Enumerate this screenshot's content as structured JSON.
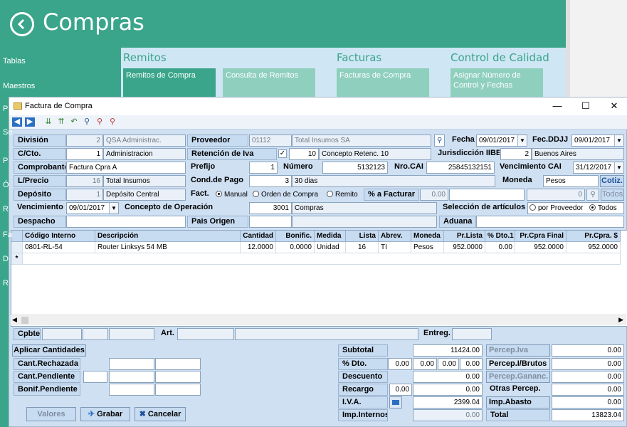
{
  "app": {
    "title": "Compras",
    "sidebar": [
      "Tablas",
      "Maestros",
      "P",
      "Se",
      "P",
      "Ó",
      "R",
      "Fa",
      "D",
      "R"
    ],
    "sections": [
      {
        "title": "Remitos",
        "tiles": [
          "Remitos de Compra",
          "Consulta de Remitos"
        ]
      },
      {
        "title": "Facturas",
        "tiles": [
          "Facturas de Compra"
        ]
      },
      {
        "title": "Control de Calidad",
        "tiles": [
          "Asignar Número de Control y Fechas"
        ]
      }
    ]
  },
  "dialog": {
    "title": "Factura de Compra",
    "header": {
      "division_label": "División",
      "division_code": "2",
      "division_name": "QSA Administrac.",
      "proveedor_label": "Proveedor",
      "proveedor_code": "01112",
      "proveedor_name": "Total Insumos SA",
      "fecha_label": "Fecha",
      "fecha_value": "09/01/2017",
      "fecddjj_label": "Fec.DDJJ",
      "fecddjj_value": "09/01/2017",
      "cto_label": "C/Cto.",
      "cto_code": "1",
      "cto_name": "Administracion",
      "retencion_label": "Retención de Iva",
      "retencion_code": "10",
      "retencion_name": "Concepto Retenc. 10",
      "jurisdiccion_label": "Jurisdicción IIBB",
      "jurisdiccion_code": "2",
      "jurisdiccion_name": "Buenos Aires",
      "comprobante_label": "Comprobante",
      "comprobante_value": "Factura Cpra  A",
      "prefijo_label": "Prefijo",
      "prefijo_value": "1",
      "numero_label": "Número",
      "numero_value": "5132123",
      "nrocai_label": "Nro.CAI",
      "nrocai_value": "25845132151",
      "vencai_label": "Vencimiento CAI",
      "vencai_value": "31/12/2017",
      "lprecio_label": "L/Precio",
      "lprecio_code": "16",
      "lprecio_name": "Total Insumos",
      "condpago_label": "Cond.de Pago",
      "condpago_code": "3",
      "condpago_name": "30 dias",
      "moneda_label": "Moneda",
      "moneda_value": "Pesos",
      "cotiz_label": "Cotiz.",
      "deposito_label": "Depósito",
      "deposito_code": "1",
      "deposito_name": "Depósito Central",
      "fact_label": "Fact.",
      "fact_opt1": "Manual",
      "fact_opt2": "Orden de Compra",
      "fact_opt3": "Remito",
      "afacturar_label": "% a Facturar",
      "afacturar_value": "0.00",
      "afacturar_num": "0",
      "todos_label": "Todos",
      "vencimiento_label": "Vencimiento",
      "vencimiento_value": "09/01/2017",
      "concepto_label": "Concepto de Operación",
      "concepto_code": "3001",
      "concepto_name": "Compras",
      "seleccion_label": "Selección de artículos",
      "sel_opt1": "por Proveedor",
      "sel_opt2": "Todos",
      "despacho_label": "Despacho",
      "pais_label": "Pais Origen",
      "aduana_label": "Aduana"
    },
    "grid": {
      "columns": [
        "Código Interno",
        "Descripción",
        "Cantidad",
        "Bonific.",
        "Medida",
        "Lista",
        "Abrev.",
        "Moneda",
        "Pr.Lista",
        "% Dto.1",
        "Pr.Cpra Final",
        "Pr.Cpra. $"
      ],
      "rows": [
        [
          "0801-RL-54",
          "Router Linksys 54 MB",
          "12.0000",
          "0.0000",
          "Unidad",
          "16",
          "TI",
          "Pesos",
          "952.0000",
          "0.00",
          "952.0000",
          "952.0000"
        ]
      ],
      "new_row_marker": "*"
    },
    "footerbar": {
      "cpbte_label": "Cpbte.",
      "art_label": "Art.",
      "entreg_label": "Entreg."
    },
    "left": {
      "aplicar_label": "Aplicar Cantidades",
      "rechazada_label": "Cant.Rechazada",
      "pendiente_label": "Cant.Pendiente",
      "bonif_label": "Bonif.Pendiente"
    },
    "totals": {
      "subtotal_label": "Subtotal",
      "subtotal_value": "11424.00",
      "dto_label": "% Dto.",
      "dto_v1": "0.00",
      "dto_v2": "0.00",
      "dto_v3": "0.00",
      "dto_v4": "0.00",
      "dto_value": "0.00",
      "descuento_label": "Descuento",
      "descuento_value": "0.00",
      "recargo_label": "Recargo",
      "recargo_pct": "0.00",
      "recargo_value": "0.00",
      "iva_label": "I.V.A.",
      "iva_value": "2399.04",
      "impint_label": "Imp.Internos",
      "impint_value": "0.00",
      "perc_iva_label": "Percep.Iva",
      "perc_iva_value": "0.00",
      "perc_ib_label": "Percep.I/Brutos",
      "perc_ib_value": "0.00",
      "perc_gan_label": "Percep.Gananc.",
      "perc_gan_value": "0.00",
      "otras_label": "Otras Percep.",
      "otras_value": "0.00",
      "abasto_label": "Imp.Abasto",
      "abasto_value": "0.00",
      "total_label": "Total",
      "total_value": "13823.04"
    },
    "buttons": {
      "valores": "Valores",
      "grabar": "Grabar",
      "cancelar": "Cancelar"
    }
  }
}
